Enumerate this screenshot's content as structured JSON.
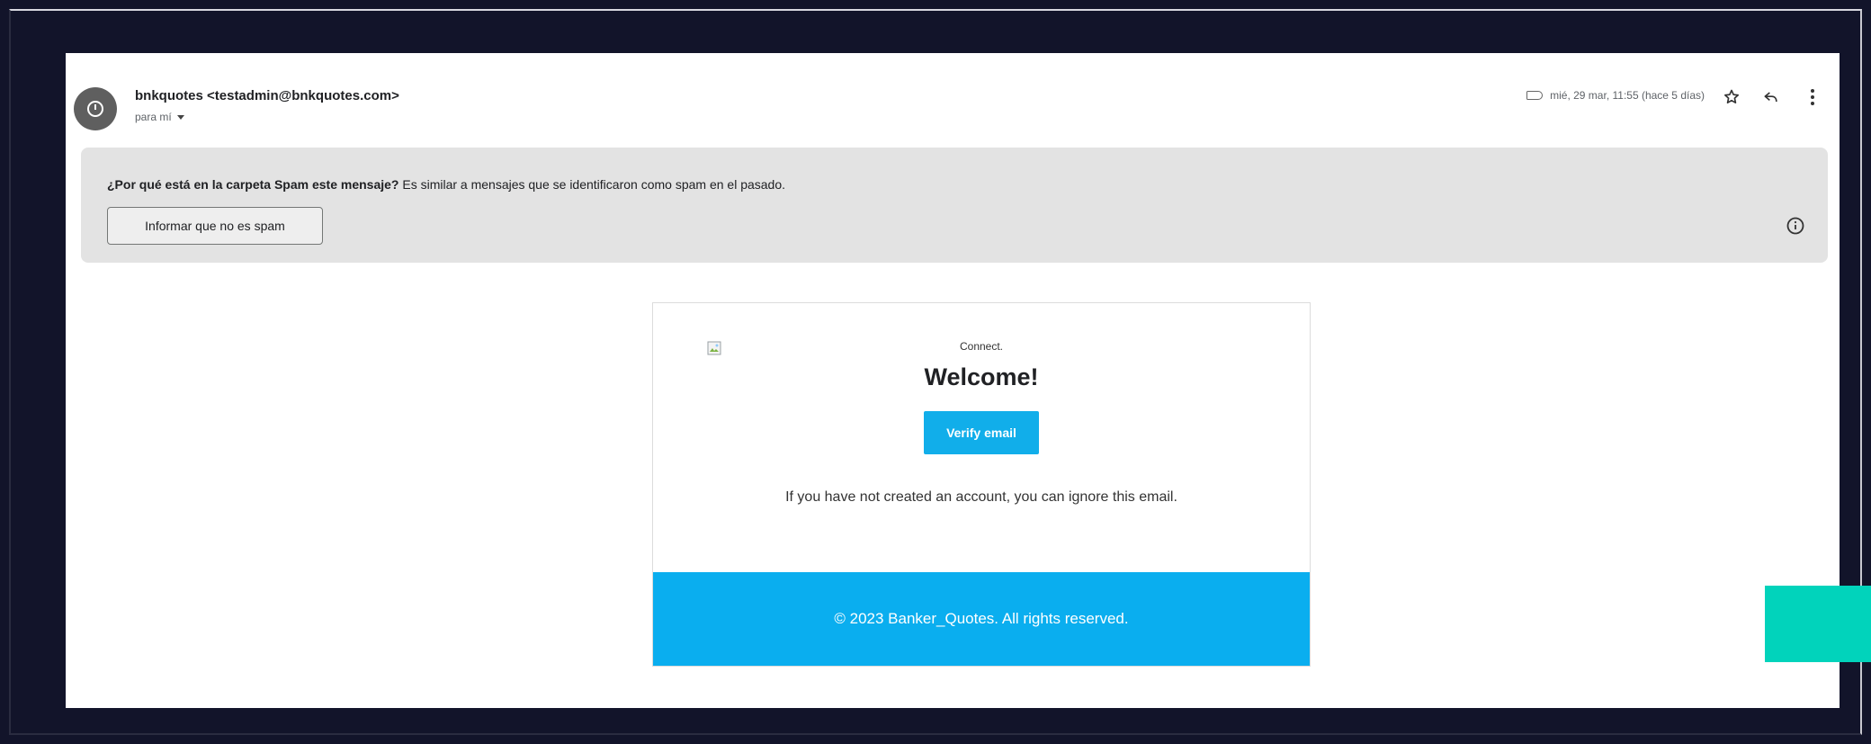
{
  "email": {
    "sender": "bnkquotes <testadmin@bnkquotes.com>",
    "recipient": "para mí",
    "date": "mié, 29 mar, 11:55 (hace 5 días)"
  },
  "spam_notice": {
    "question": "¿Por qué está en la carpeta Spam este mensaje?",
    "reason": " Es similar a mensajes que se identificaron como spam en el pasado.",
    "button_label": "Informar que no es spam"
  },
  "body": {
    "logo_alt": "Connect.",
    "heading": "Welcome!",
    "verify_button": "Verify email",
    "ignore_text": "If you have not created an account, you can ignore this email.",
    "footer_text": "© 2023 Banker_Quotes. All rights reserved."
  },
  "colors": {
    "background": "#12142a",
    "button_blue": "#11aeea",
    "footer_blue": "#0aaeef",
    "accent_teal": "#01d3bb"
  }
}
